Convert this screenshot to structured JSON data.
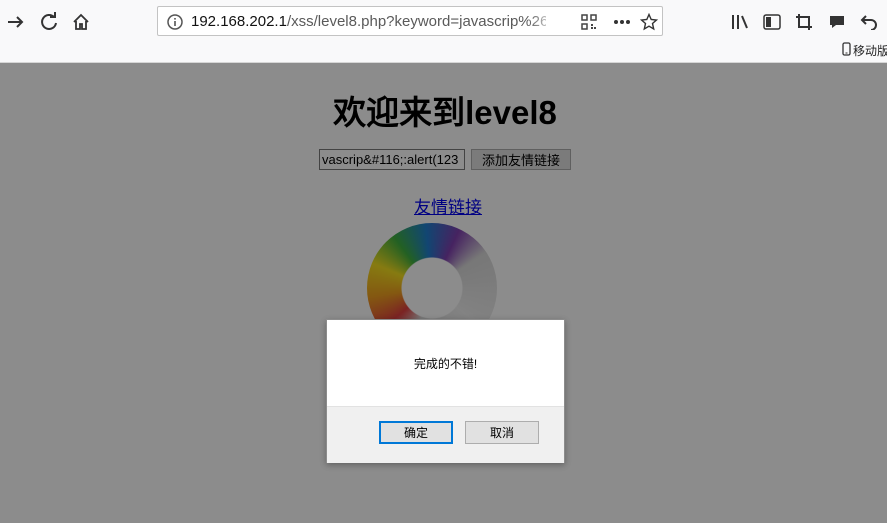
{
  "browser": {
    "url_host": "192.168.202.1",
    "url_path": "/xss/level8.php?keyword=javascrip%26%",
    "bookmark_label": "移动版"
  },
  "page": {
    "title": "欢迎来到level8",
    "keyword_value": "vascrip&#116;:alert(123",
    "add_button_label": "添加友情链接",
    "friend_link_label": "友情链接"
  },
  "dialog": {
    "message": "完成的不错!",
    "ok_label": "确定",
    "cancel_label": "取消"
  },
  "colors": {
    "link": "#0000ee",
    "primary_button_border": "#0078d7"
  }
}
